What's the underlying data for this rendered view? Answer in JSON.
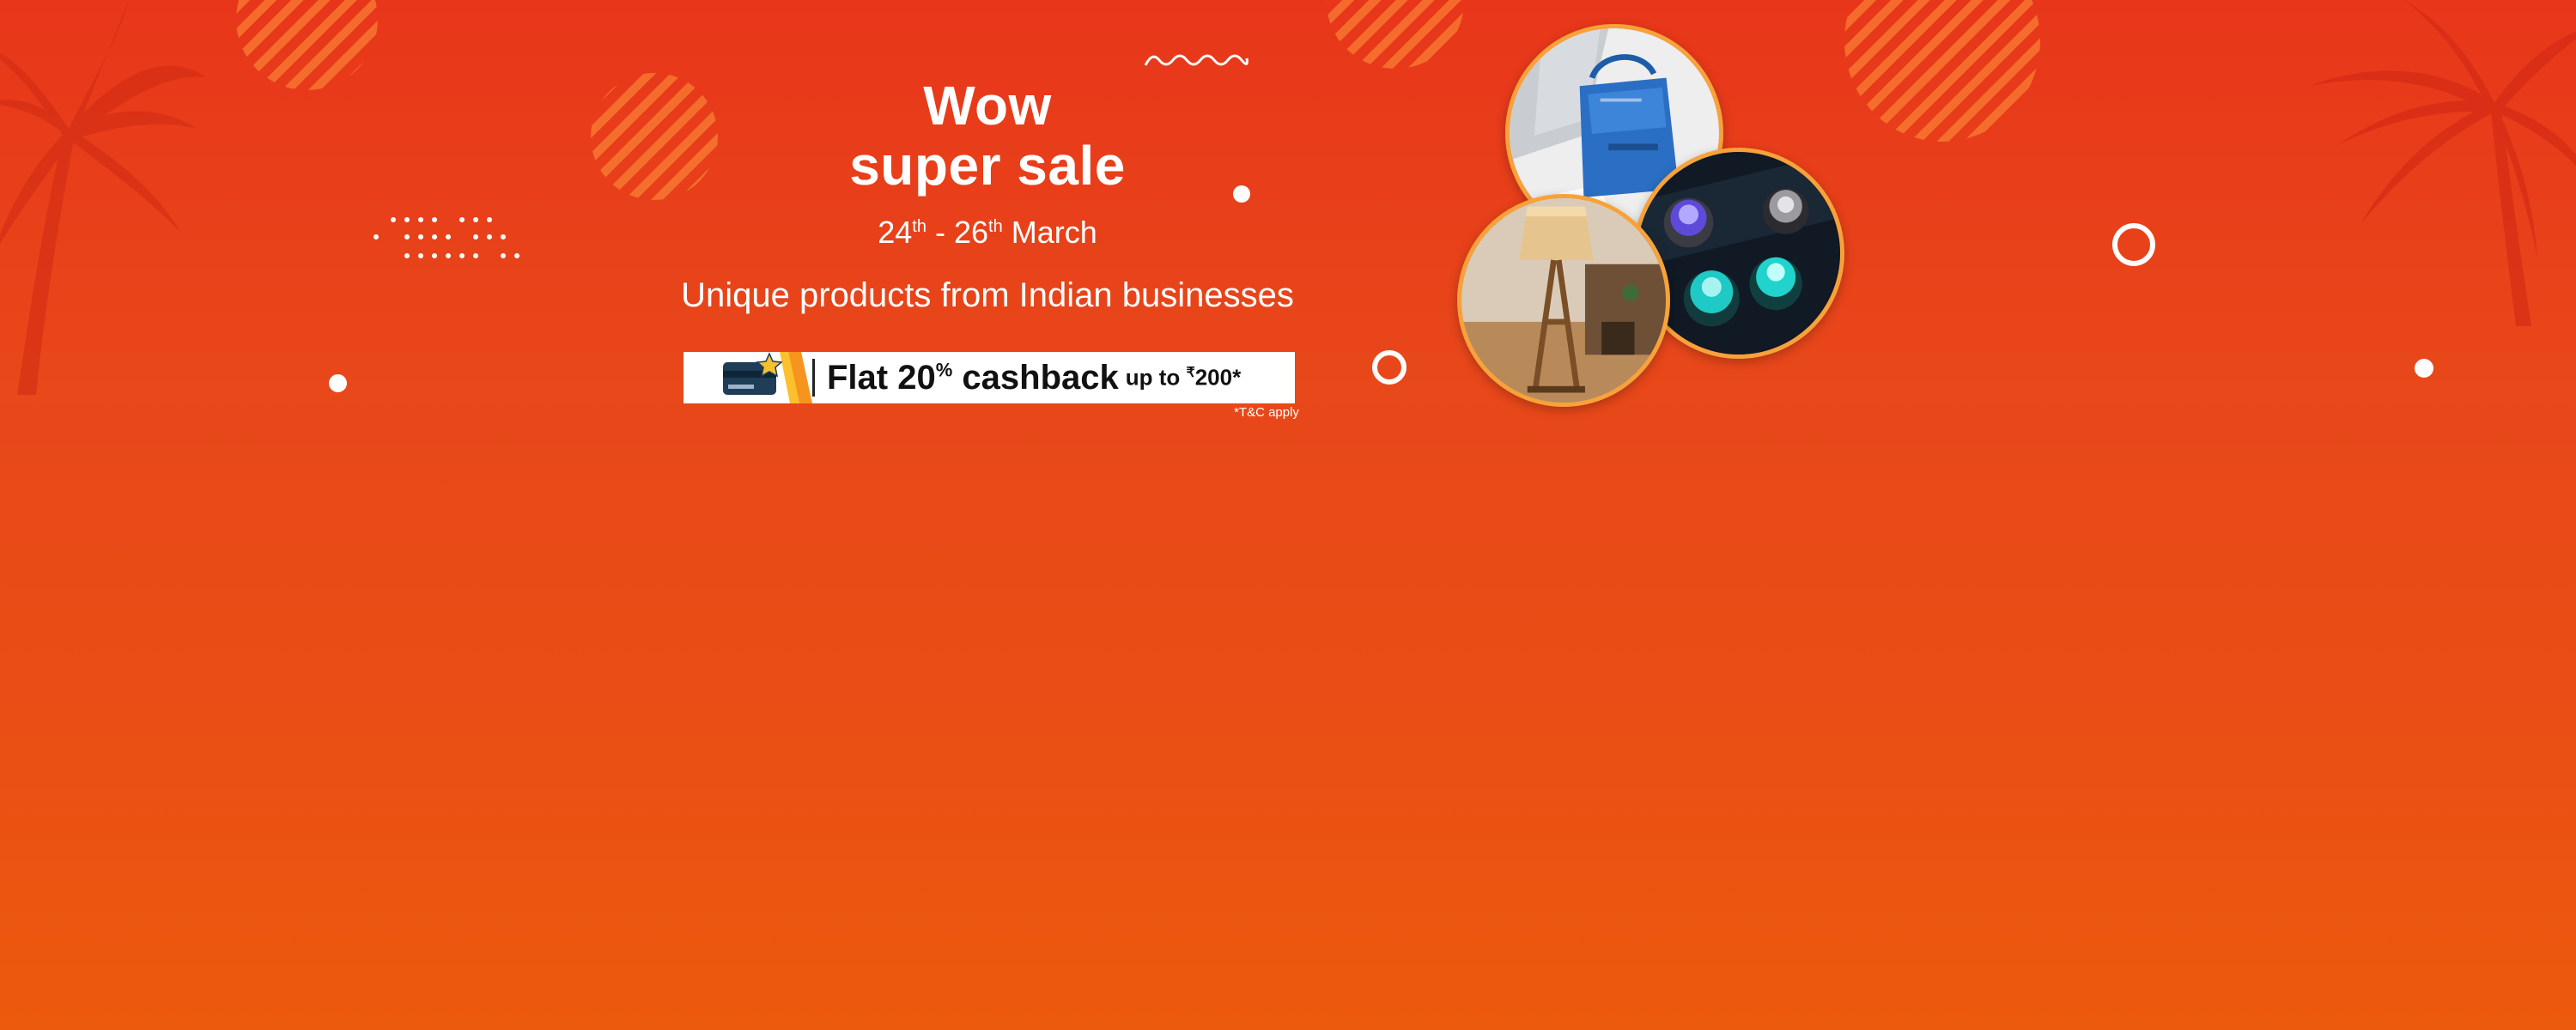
{
  "banner": {
    "headline_line1": "Wow",
    "headline_line2": "super sale",
    "dates": {
      "start_day": "24",
      "start_suffix": "th",
      "separator": " - ",
      "end_day": "26",
      "end_suffix": "th",
      "month": " March"
    },
    "subtitle": "Unique products from Indian businesses",
    "cashback": {
      "offer_prefix": "Flat 20",
      "offer_percent": "%",
      "offer_suffix": " cashback",
      "upto_prefix": "up to ",
      "currency": "₹",
      "upto_amount": "200*"
    },
    "tnc": "*T&C apply"
  },
  "icons": {
    "card": "credit-card-with-star-icon",
    "palm": "palm-tree-icon"
  },
  "colors": {
    "background_top": "#e8361a",
    "background_bottom": "#ec5a0d",
    "photo_border": "#f7a23a",
    "text": "#ffffff"
  }
}
